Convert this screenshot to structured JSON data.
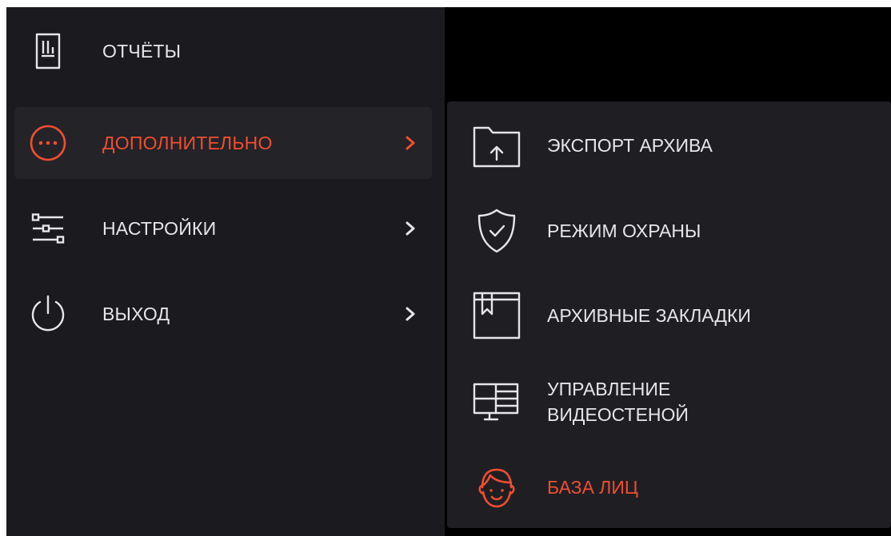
{
  "colors": {
    "accent": "#f04e30",
    "text": "#e6e6e8",
    "menu_bg": "#1b1b1f",
    "active_bg": "#232328",
    "submenu_bg": "#1f1f23"
  },
  "main_menu": {
    "items": [
      {
        "label": "ОТЧЁТЫ",
        "icon": "report-icon",
        "has_submenu": false
      },
      {
        "label": "ДОПОЛНИТЕЛЬНО",
        "icon": "more-dots-icon",
        "has_submenu": true,
        "active": true
      },
      {
        "label": "НАСТРОЙКИ",
        "icon": "settings-sliders-icon",
        "has_submenu": true
      },
      {
        "label": "ВЫХОД",
        "icon": "power-icon",
        "has_submenu": true
      }
    ]
  },
  "submenu": {
    "items": [
      {
        "label": "ЭКСПОРТ АРХИВА",
        "icon": "folder-upload-icon"
      },
      {
        "label": "РЕЖИМ ОХРАНЫ",
        "icon": "shield-check-icon"
      },
      {
        "label": "АРХИВНЫЕ ЗАКЛАДКИ",
        "icon": "bookmark-icon"
      },
      {
        "label_line1": "УПРАВЛЕНИЕ",
        "label_line2": "ВИДЕОСТЕНОЙ",
        "icon": "video-wall-icon"
      },
      {
        "label": "БАЗА ЛИЦ",
        "icon": "face-icon",
        "accent": true
      }
    ]
  }
}
